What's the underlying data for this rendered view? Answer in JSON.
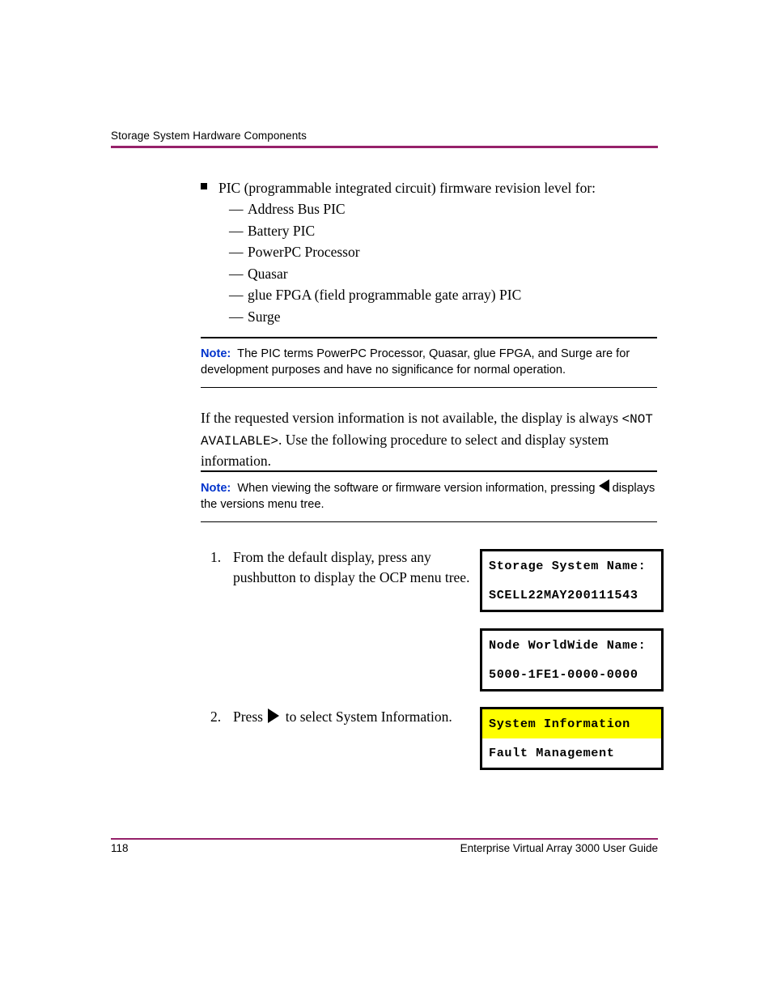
{
  "header": {
    "title": "Storage System Hardware Components",
    "rule_color": "#96216A"
  },
  "bullet": {
    "marker": "square-bullet",
    "text": "PIC (programmable integrated circuit) firmware revision level for:",
    "subitems": [
      {
        "dash": "—",
        "label": "Address Bus PIC"
      },
      {
        "dash": "—",
        "label": "Battery PIC"
      },
      {
        "dash": "—",
        "label": "PowerPC Processor"
      },
      {
        "dash": "—",
        "label": "Quasar"
      },
      {
        "dash": "—",
        "label": "glue FPGA (field programmable gate array) PIC"
      },
      {
        "dash": "—",
        "label": "Surge"
      }
    ]
  },
  "note1": {
    "label": "Note:",
    "label_color": "#0033CC",
    "text": "The PIC terms PowerPC Processor, Quasar, glue FPGA, and Surge are for development purposes and have no significance for normal operation."
  },
  "paragraph": {
    "part1": "If the requested version information is not available, the display is always ",
    "mono": "<NOT AVAILABLE>",
    "part2": ". Use the following procedure to select and display system information."
  },
  "note2": {
    "label": "Note:",
    "label_color": "#0033CC",
    "text_before": "When viewing the software or firmware version information, pressing ",
    "arrow": "left-triangle",
    "text_after": "displays the versions menu tree."
  },
  "steps": [
    {
      "number": "1.",
      "text": "From the default display, press any pushbutton to display the OCP menu tree."
    },
    {
      "number": "2.",
      "text_before": "Press ",
      "arrow": "right-triangle",
      "text_after": " to select System Information."
    }
  ],
  "lcd_displays": [
    {
      "name": "storage-system-name",
      "lines": [
        {
          "text": "Storage System Name:",
          "highlight": false
        },
        {
          "text": "SCELL22MAY200111543",
          "highlight": false
        }
      ]
    },
    {
      "name": "node-worldwide-name",
      "lines": [
        {
          "text": "Node WorldWide Name:",
          "highlight": false
        },
        {
          "text": "5000-1FE1-0000-0000",
          "highlight": false
        }
      ]
    },
    {
      "name": "ocp-menu",
      "lines": [
        {
          "text": "System Information",
          "highlight": true
        },
        {
          "text": "Fault Management",
          "highlight": false
        }
      ]
    }
  ],
  "highlight_color": "#FFFF00",
  "footer": {
    "page_number": "118",
    "guide_title": "Enterprise Virtual Array 3000 User Guide",
    "rule_color": "#96216A"
  }
}
